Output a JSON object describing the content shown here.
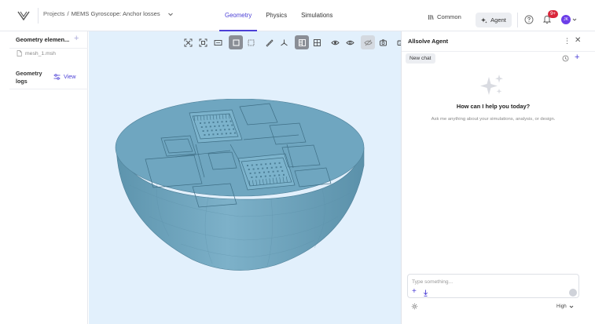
{
  "header": {
    "breadcrumb_root": "Projects",
    "breadcrumb_sep": "/",
    "project_name": "MEMS Gyroscope: Anchor losses",
    "tabs": [
      {
        "label": "Geometry",
        "active": true
      },
      {
        "label": "Physics",
        "active": false
      },
      {
        "label": "Simulations",
        "active": false
      }
    ],
    "common_label": "Common",
    "agent_label": "Agent",
    "notification_count": "9+",
    "avatar_initials": "JK"
  },
  "left_panel": {
    "title": "Geometry elemen...",
    "file_name": "mesh_1.msh",
    "logs_label": "Geometry logs",
    "view_label": "View"
  },
  "viewport": {
    "toolbar_icons": [
      "fit-view-icon",
      "focus-icon",
      "frame-icon",
      "solid-box-icon",
      "wireframe-box-icon",
      "measure-ruler-icon",
      "axes-icon",
      "section-view-icon",
      "grid-view-icon",
      "show-icon",
      "hide-icon",
      "visibility-off-icon",
      "screenshot-icon",
      "keyboard-icon",
      "view-settings-icon"
    ],
    "model": "hemispherical substrate with MEMS gyroscope structure"
  },
  "agent_panel": {
    "title": "Allsolve Agent",
    "new_chat_label": "New chat",
    "heading": "How can I help you today?",
    "subtext": "Ask me anything about your simulations, analysis, or design.",
    "input_placeholder": "Type something...",
    "quality_label": "High"
  },
  "colors": {
    "accent": "#4b3fd6",
    "viewport_bg": "#e2f0fc",
    "model_blue": "#6fa6c0",
    "badge_red": "#d9263a",
    "avatar_purple": "#6c3ee8"
  }
}
